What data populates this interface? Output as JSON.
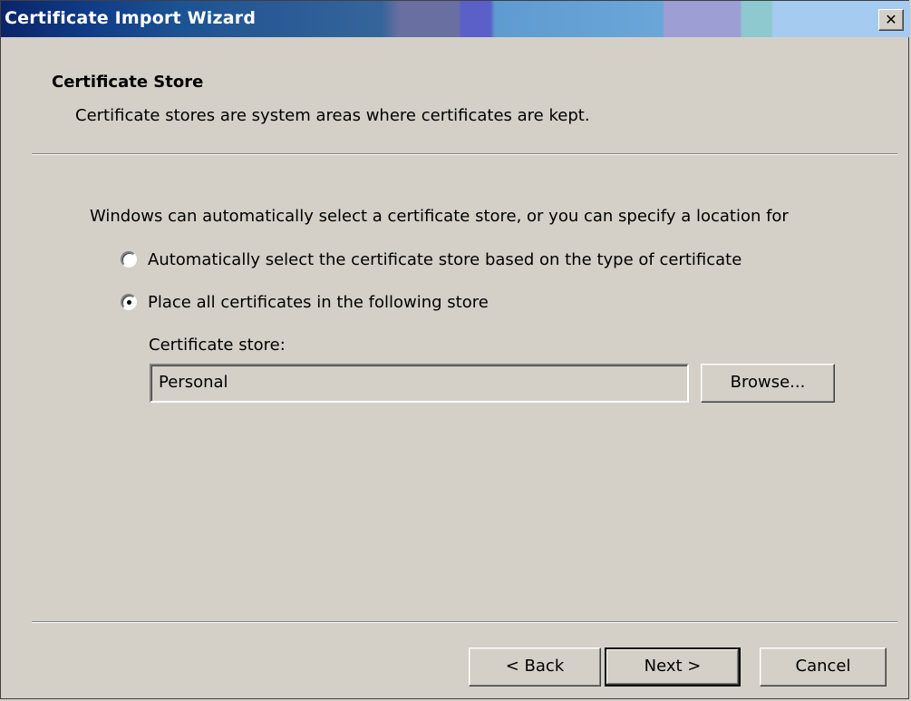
{
  "window": {
    "title": "Certificate Import Wizard",
    "close_glyph": "✕"
  },
  "header": {
    "title": "Certificate Store",
    "description": "Certificate stores are system areas where certificates are kept."
  },
  "body": {
    "intro": "Windows can automatically select a certificate store, or you can specify a location for",
    "options": [
      {
        "label": "Automatically select the certificate store based on the type of certificate",
        "selected": false
      },
      {
        "label": "Place all certificates in the following store",
        "selected": true
      }
    ],
    "store_label": "Certificate store:",
    "store_value": "Personal",
    "browse_label": "Browse..."
  },
  "footer": {
    "back_label": "< Back",
    "next_label": "Next >",
    "cancel_label": "Cancel"
  },
  "colors": {
    "face": "#d4d0c8",
    "title_start": "#0a246a",
    "title_end": "#a6cbf0"
  }
}
